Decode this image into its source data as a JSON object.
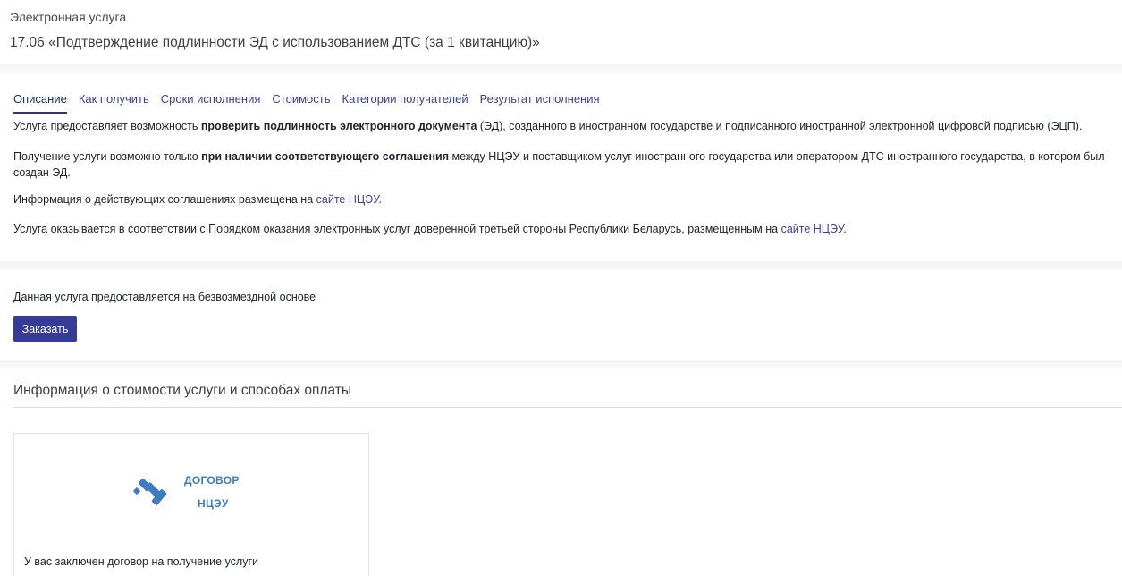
{
  "header": {
    "subtitle": "Электронная услуга",
    "title": "17.06 «Подтверждение подлинности ЭД с использованием ДТС (за 1 квитанцию)»"
  },
  "tabs": [
    {
      "label": "Описание",
      "active": true
    },
    {
      "label": "Как получить"
    },
    {
      "label": "Сроки исполнения"
    },
    {
      "label": "Стоимость"
    },
    {
      "label": "Категории получателей"
    },
    {
      "label": "Результат исполнения"
    }
  ],
  "description": {
    "p1_pre": "Услуга предоставляет возможность ",
    "p1_bold": "проверить подлинность электронного документа",
    "p1_post": " (ЭД), созданного в иностранном государстве и подписанного иностранной электронной цифровой подписью (ЭЦП).",
    "p2_pre": "Получение услуги возможно только ",
    "p2_bold": "при наличии соответствующего соглашения",
    "p2_post": " между НЦЭУ и поставщиком услуг иностранного государства или оператором ДТС иностранного государства, в котором был создан ЭД.",
    "p3_pre": "Информация о действующих соглашениях размещена на ",
    "p3_link": "сайте НЦЭУ",
    "p3_post": ".",
    "p4_pre": "Услуга оказывается в соответствии с Порядком оказания электронных услуг доверенной третьей стороны Республики Беларусь, размещенным на ",
    "p4_link": "сайте НЦЭУ",
    "p4_post": "."
  },
  "order": {
    "free_text": "Данная услуга предоставляется на безвозмездной основе",
    "button_label": "Заказать"
  },
  "payment": {
    "title": "Информация о стоимости услуги и способах оплаты",
    "card": {
      "logo_line1": "ДОГОВОР",
      "logo_line2": "НЦЭУ",
      "text": "У вас заключен договор на получение услуги"
    }
  },
  "colors": {
    "accent": "#363b98",
    "link": "#3a3f9c",
    "logo": "#3d7bc4"
  }
}
